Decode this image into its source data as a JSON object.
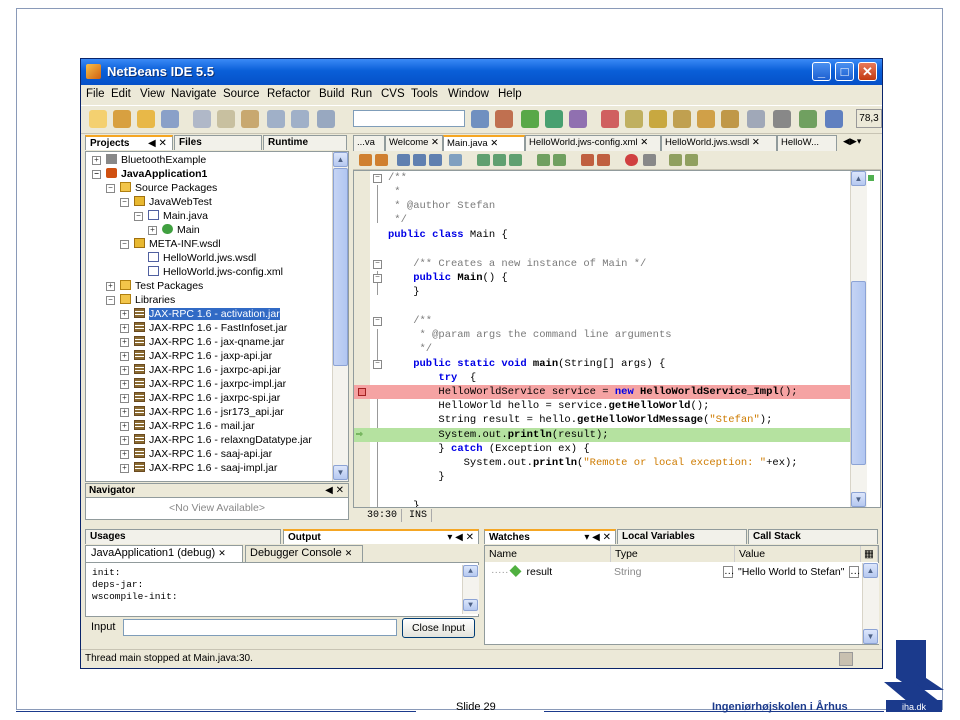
{
  "window": {
    "title": "NetBeans IDE 5.5",
    "zoom_readout": "78,3"
  },
  "menu": [
    "File",
    "Edit",
    "View",
    "Navigate",
    "Source",
    "Refactor",
    "Build",
    "Run",
    "CVS",
    "Tools",
    "Window",
    "Help"
  ],
  "left_tabs": {
    "projects": "Projects",
    "files": "Files",
    "runtime": "Runtime"
  },
  "project_tree": [
    {
      "label": "BluetoothExample"
    },
    {
      "label": "JavaApplication1"
    },
    {
      "label": "Source Packages"
    },
    {
      "label": "JavaWebTest"
    },
    {
      "label": "Main.java"
    },
    {
      "label": "Main"
    },
    {
      "label": "META-INF.wsdl"
    },
    {
      "label": "HelloWorld.jws.wsdl"
    },
    {
      "label": "HelloWorld.jws-config.xml"
    },
    {
      "label": "Test Packages"
    },
    {
      "label": "Libraries"
    },
    {
      "label": "JAX-RPC 1.6 - activation.jar"
    },
    {
      "label": "JAX-RPC 1.6 - FastInfoset.jar"
    },
    {
      "label": "JAX-RPC 1.6 - jax-qname.jar"
    },
    {
      "label": "JAX-RPC 1.6 - jaxp-api.jar"
    },
    {
      "label": "JAX-RPC 1.6 - jaxrpc-api.jar"
    },
    {
      "label": "JAX-RPC 1.6 - jaxrpc-impl.jar"
    },
    {
      "label": "JAX-RPC 1.6 - jaxrpc-spi.jar"
    },
    {
      "label": "JAX-RPC 1.6 - jsr173_api.jar"
    },
    {
      "label": "JAX-RPC 1.6 - mail.jar"
    },
    {
      "label": "JAX-RPC 1.6 - relaxngDatatype.jar"
    },
    {
      "label": "JAX-RPC 1.6 - saaj-api.jar"
    },
    {
      "label": "JAX-RPC 1.6 - saaj-impl.jar"
    }
  ],
  "navigator": {
    "title": "Navigator",
    "empty": "<No View Available>"
  },
  "editor_tabs": [
    "...va",
    "Welcome",
    "Main.java",
    "HelloWorld.jws-config.xml",
    "HelloWorld.jws.wsdl",
    "HelloW..."
  ],
  "code": {
    "l1": "/**",
    "l2": " *",
    "l3": " * @author Stefan",
    "l4": " */",
    "l5_kw": "public class",
    "l5_rest": " Main {",
    "l7": "    /** Creates a new instance of Main */",
    "l8_kw": "    public",
    "l8_b": " Main",
    "l8_rest": "() {",
    "l9": "    }",
    "l11": "    /**",
    "l12": "     * @param args the command line arguments",
    "l13": "     */",
    "l14_kw": "    public static void",
    "l14_b": " main",
    "l14_rest": "(String[] args) {",
    "l15_kw": "        try",
    "l15_rest": "  {",
    "l16_a": "        HelloWorldService service = ",
    "l16_kw": "new",
    "l16_b": " HelloWorldService_Impl",
    "l16_rest": "();",
    "l17_a": "        HelloWorld hello = service.",
    "l17_b": "getHelloWorld",
    "l17_rest": "();",
    "l18_a": "        String result = hello.",
    "l18_b": "getHelloWorldMessage",
    "l18_c": "(",
    "l18_st": "\"Stefan\"",
    "l18_rest": ");",
    "l19_a": "        System.out.",
    "l19_b": "println",
    "l19_rest": "(result);",
    "l20_a": "        } ",
    "l20_kw": "catch",
    "l20_rest": " (Exception ex) {",
    "l21_a": "            System.out.",
    "l21_b": "println",
    "l21_c": "(",
    "l21_st": "\"Remote or local exception: \"",
    "l21_rest": "+ex);",
    "l22": "        }",
    "l24": "    }"
  },
  "editor_status": {
    "position": "30:30",
    "mode": "INS"
  },
  "bottom_left_tabs": {
    "usages": "Usages",
    "output": "Output"
  },
  "output_subtabs": {
    "debug": "JavaApplication1 (debug)",
    "console": "Debugger Console"
  },
  "output_lines": [
    "init:",
    "deps-jar:",
    "wscompile-init:"
  ],
  "input_label": "Input",
  "close_input": "Close Input",
  "watch_tabs": {
    "watches": "Watches",
    "locals": "Local Variables",
    "callstack": "Call Stack"
  },
  "watch_columns": {
    "name": "Name",
    "type": "Type",
    "value": "Value"
  },
  "watch_row": {
    "name": "result",
    "type": "String",
    "value": "\"Hello World to Stefan\""
  },
  "status": "Thread main stopped at Main.java:30.",
  "slide": {
    "number": "Slide 29",
    "school": "Ingeniørhøjskolen i Århus",
    "logo_text": "iha.dk"
  }
}
